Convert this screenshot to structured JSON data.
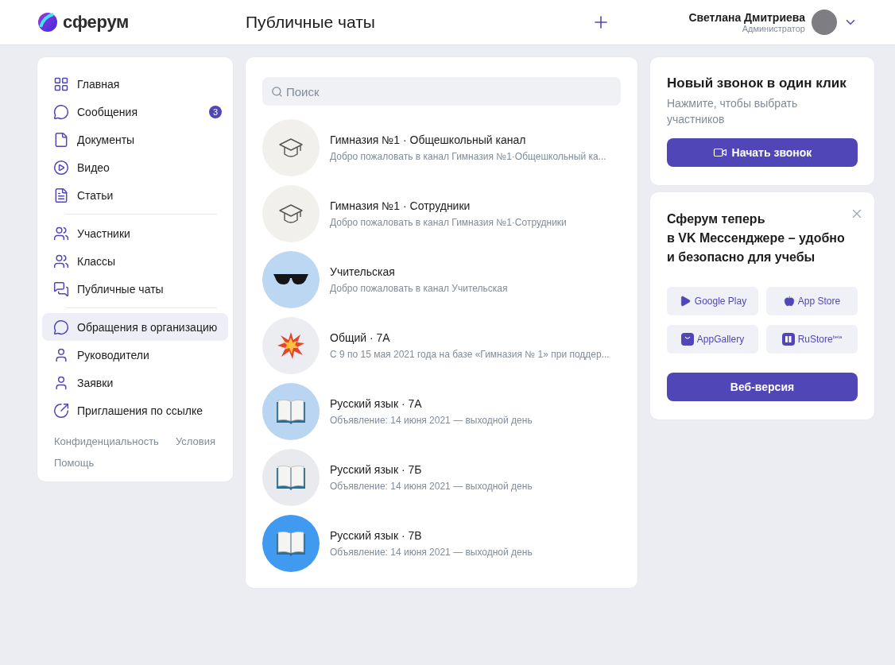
{
  "header": {
    "logo_text": "сферум",
    "title": "Публичные чаты",
    "user": {
      "name": "Светлана Дмитриева",
      "role": "Администратор"
    }
  },
  "sidebar": {
    "groups": [
      [
        {
          "kind": "grid",
          "label": "Главная",
          "selected": false
        },
        {
          "kind": "message",
          "label": "Сообщения",
          "badge": "3",
          "selected": false
        },
        {
          "kind": "document",
          "label": "Документы",
          "selected": false
        },
        {
          "kind": "video",
          "label": "Видео",
          "selected": false
        },
        {
          "kind": "article",
          "label": "Статьи",
          "selected": false
        }
      ],
      [
        {
          "kind": "users",
          "label": "Участники",
          "selected": false
        },
        {
          "kind": "classes",
          "label": "Классы",
          "selected": false
        },
        {
          "kind": "chats",
          "label": "Публичные чаты",
          "selected": false
        }
      ],
      [
        {
          "kind": "message",
          "label": "Обращения в организацию",
          "selected": true
        },
        {
          "kind": "user",
          "label": "Руководители",
          "selected": false
        },
        {
          "kind": "user-arrow",
          "label": "Заявки",
          "selected": false
        },
        {
          "kind": "link",
          "label": "Приглашения по ссылке",
          "selected": false
        }
      ]
    ],
    "footer_links": [
      "Конфиденциальность",
      "Условия",
      "Помощь"
    ]
  },
  "chats": {
    "search": {
      "placeholder": "Поиск"
    },
    "items": [
      {
        "kind": "cap",
        "color": "#f1f0ec",
        "title": "Гимназия №1 · Общешкольный канал",
        "preview": "Добро пожаловать в канал Гимназия №1·Общешкольный ка..."
      },
      {
        "kind": "cap",
        "color": "#f1f0ec",
        "title": "Гимназия №1 · Сотрудники",
        "preview": "Добро пожаловать в канал Гимназия №1·Сотрудники"
      },
      {
        "kind": "glasses",
        "color": "#bcd7f2",
        "title": "Учительская",
        "preview": "Добро пожаловать в канал Учительская"
      },
      {
        "kind": "burst",
        "color": "#ecedf1",
        "title": "Общий · 7А",
        "preview": "С 9 по 15 мая 2021 года на базе «Гимназия № 1» при поддер..."
      },
      {
        "kind": "book",
        "color": "#b9d5f2",
        "title": "Русский язык · 7А",
        "preview": "Объявление: 14 июня 2021 — выходной день"
      },
      {
        "kind": "book",
        "color": "#e9eaee",
        "title": "Русский язык · 7Б",
        "preview": "Объявление: 14 июня 2021 — выходной день"
      },
      {
        "kind": "book",
        "color": "#3f9af0",
        "title": "Русский язык · 7В",
        "preview": "Объявление: 14 июня 2021 — выходной день"
      }
    ]
  },
  "call_card": {
    "title": "Новый звонок в один клик",
    "subtitle": "Нажмите, чтобы выбрать участников",
    "button": "Начать звонок"
  },
  "promo_card": {
    "title_lines": [
      "Сферум теперь",
      "в VK Мессенджере – удобно",
      "и безопасно для учебы"
    ],
    "stores": [
      {
        "kind": "google-play",
        "label": "Google Play"
      },
      {
        "kind": "app-store",
        "label": "App Store"
      },
      {
        "kind": "appgallery",
        "label": "AppGallery"
      },
      {
        "kind": "rustore",
        "label": "RuStore$^{beta}$"
      }
    ],
    "button": "Веб-версия"
  }
}
